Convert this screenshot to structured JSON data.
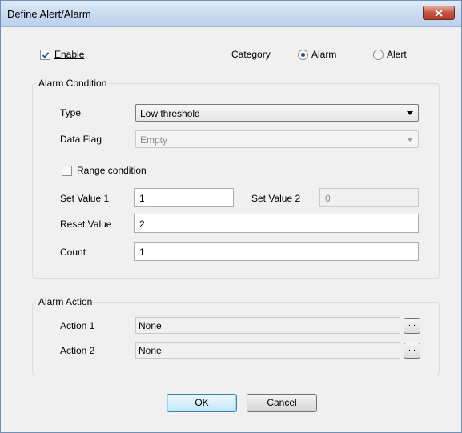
{
  "window": {
    "title": "Define Alert/Alarm"
  },
  "enable": {
    "label": "Enable",
    "checked": true
  },
  "category": {
    "label": "Category",
    "options": [
      {
        "label": "Alarm",
        "selected": true
      },
      {
        "label": "Alert",
        "selected": false
      }
    ]
  },
  "alarm_condition": {
    "title": "Alarm Condition",
    "type_label": "Type",
    "type_value": "Low threshold",
    "data_flag_label": "Data Flag",
    "data_flag_value": "Empty",
    "range_label": "Range condition",
    "range_checked": false,
    "set_value_1_label": "Set Value 1",
    "set_value_1": "1",
    "set_value_2_label": "Set Value 2",
    "set_value_2": "0",
    "reset_value_label": "Reset Value",
    "reset_value": "2",
    "count_label": "Count",
    "count_value": "1"
  },
  "alarm_action": {
    "title": "Alarm Action",
    "action_1_label": "Action 1",
    "action_1_value": "None",
    "action_2_label": "Action 2",
    "action_2_value": "None",
    "browse_label": "..."
  },
  "buttons": {
    "ok": "OK",
    "cancel": "Cancel"
  },
  "colors": {
    "titlebar": "#c8daf0",
    "close": "#c75342",
    "dialog": "#f0f0f0"
  }
}
